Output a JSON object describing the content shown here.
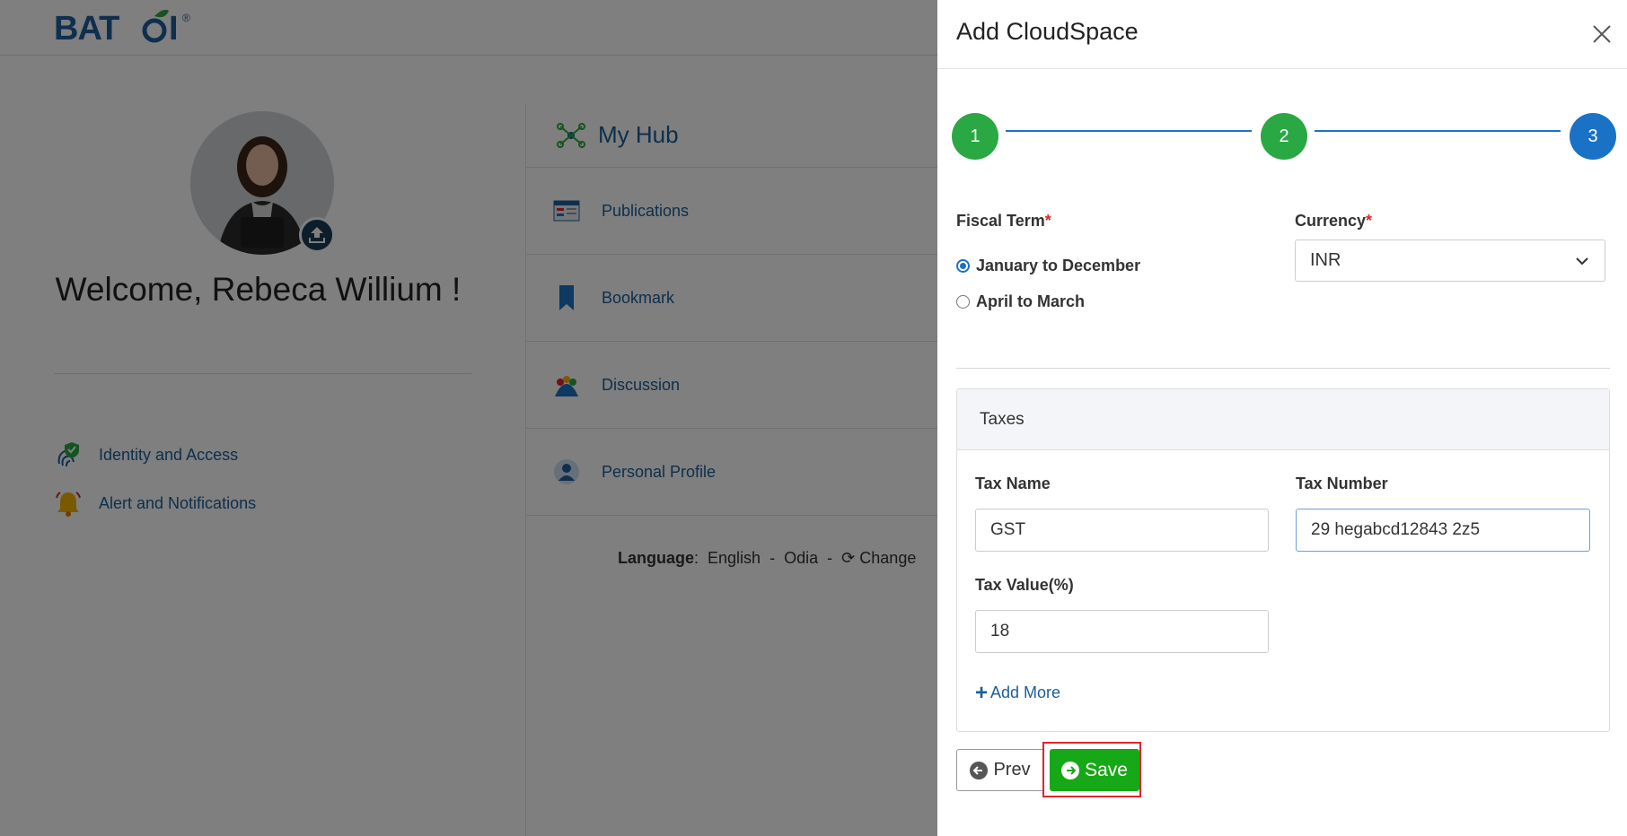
{
  "brand": {
    "logo_text": "BATOI®"
  },
  "profile": {
    "welcome": "Welcome, Rebeca Willium !",
    "links": [
      {
        "label": "Identity and Access",
        "icon": "fingerprint-shield-icon"
      },
      {
        "label": "Alert and Notifications",
        "icon": "bell-icon"
      }
    ]
  },
  "hub": {
    "title": "My Hub",
    "items": [
      {
        "label": "Publications",
        "icon": "publications-icon"
      },
      {
        "label": "Bookmark",
        "icon": "bookmark-icon"
      },
      {
        "label": "Discussion",
        "icon": "discussion-icon"
      },
      {
        "label": "Personal Profile",
        "icon": "user-icon"
      }
    ]
  },
  "language": {
    "label": "Language",
    "options": [
      "English",
      "Odia"
    ],
    "sep": "-",
    "change": "Change"
  },
  "drawer": {
    "title": "Add CloudSpace",
    "steps": [
      "1",
      "2",
      "3"
    ],
    "fiscal_term": {
      "label": "Fiscal Term",
      "options": [
        "January to December",
        "April to March"
      ],
      "selected": "January to December"
    },
    "currency": {
      "label": "Currency",
      "value": "INR"
    },
    "taxes": {
      "title": "Taxes",
      "tax_name": {
        "label": "Tax Name",
        "value": "GST"
      },
      "tax_number": {
        "label": "Tax Number",
        "value": "29 hegabcd12843 2z5"
      },
      "tax_value": {
        "label": "Tax Value(%)",
        "value": "18"
      },
      "add_more": "Add More"
    },
    "prev": "Prev",
    "save": "Save"
  },
  "colors": {
    "accent": "#1a72c7",
    "step_done": "#2aa843",
    "save": "#17a817",
    "required": "#e0252b",
    "link": "#1a5e99"
  }
}
